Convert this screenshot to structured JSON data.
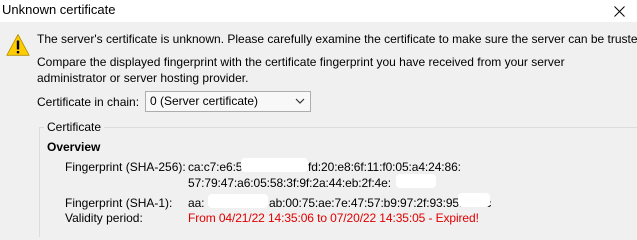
{
  "window": {
    "title": "Unknown certificate",
    "close_glyph": "✕"
  },
  "icons": {
    "warning": "warning-icon",
    "close": "close-icon",
    "dropdown": "chevron-down-icon"
  },
  "colors": {
    "warning_yellow": "#ffcc00",
    "expired_red": "#e00000"
  },
  "message": {
    "line1": "The server's certificate is unknown. Please carefully examine the certificate to make sure the server can be trusted.",
    "line2": "Compare the displayed fingerprint with the certificate fingerprint you have received from your server",
    "line3": "administrator or server hosting provider."
  },
  "chain": {
    "label": "Certificate in chain:",
    "selected": "0 (Server certificate)"
  },
  "certificate": {
    "group_label": "Certificate",
    "overview_heading": "Overview",
    "sha256_label": "Fingerprint (SHA-256):",
    "sha256_line1_a": "ca:c7:e6:5",
    "sha256_line1_b": "fd:20:e8:6f:11:f0:05:a4:24:86:",
    "sha256_line2_a": "57:79:47:a6:05:58:3f:9f:2a:44:eb:2f:4e:",
    "sha1_label": "Fingerprint (SHA-1):",
    "sha1_a": "aa:",
    "sha1_b": "ab:00:75:ae:7e:47:57:b9:97:2f:93:95:a5:bc",
    "validity_label": "Validity period:",
    "validity_value": "From 04/21/22 14:35:06 to 07/20/22 14:35:05 - Expired!"
  }
}
